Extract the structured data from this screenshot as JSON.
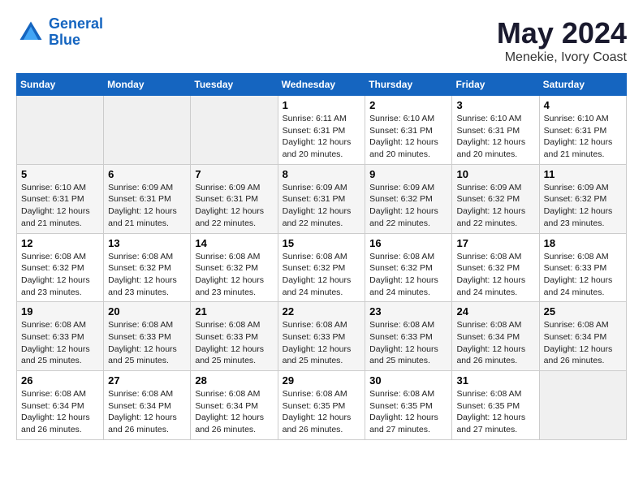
{
  "header": {
    "logo_line1": "General",
    "logo_line2": "Blue",
    "month_year": "May 2024",
    "location": "Menekie, Ivory Coast"
  },
  "weekdays": [
    "Sunday",
    "Monday",
    "Tuesday",
    "Wednesday",
    "Thursday",
    "Friday",
    "Saturday"
  ],
  "weeks": [
    [
      null,
      null,
      null,
      {
        "day": "1",
        "sunrise": "Sunrise: 6:11 AM",
        "sunset": "Sunset: 6:31 PM",
        "daylight": "Daylight: 12 hours and 20 minutes."
      },
      {
        "day": "2",
        "sunrise": "Sunrise: 6:10 AM",
        "sunset": "Sunset: 6:31 PM",
        "daylight": "Daylight: 12 hours and 20 minutes."
      },
      {
        "day": "3",
        "sunrise": "Sunrise: 6:10 AM",
        "sunset": "Sunset: 6:31 PM",
        "daylight": "Daylight: 12 hours and 20 minutes."
      },
      {
        "day": "4",
        "sunrise": "Sunrise: 6:10 AM",
        "sunset": "Sunset: 6:31 PM",
        "daylight": "Daylight: 12 hours and 21 minutes."
      }
    ],
    [
      {
        "day": "5",
        "sunrise": "Sunrise: 6:10 AM",
        "sunset": "Sunset: 6:31 PM",
        "daylight": "Daylight: 12 hours and 21 minutes."
      },
      {
        "day": "6",
        "sunrise": "Sunrise: 6:09 AM",
        "sunset": "Sunset: 6:31 PM",
        "daylight": "Daylight: 12 hours and 21 minutes."
      },
      {
        "day": "7",
        "sunrise": "Sunrise: 6:09 AM",
        "sunset": "Sunset: 6:31 PM",
        "daylight": "Daylight: 12 hours and 22 minutes."
      },
      {
        "day": "8",
        "sunrise": "Sunrise: 6:09 AM",
        "sunset": "Sunset: 6:31 PM",
        "daylight": "Daylight: 12 hours and 22 minutes."
      },
      {
        "day": "9",
        "sunrise": "Sunrise: 6:09 AM",
        "sunset": "Sunset: 6:32 PM",
        "daylight": "Daylight: 12 hours and 22 minutes."
      },
      {
        "day": "10",
        "sunrise": "Sunrise: 6:09 AM",
        "sunset": "Sunset: 6:32 PM",
        "daylight": "Daylight: 12 hours and 22 minutes."
      },
      {
        "day": "11",
        "sunrise": "Sunrise: 6:09 AM",
        "sunset": "Sunset: 6:32 PM",
        "daylight": "Daylight: 12 hours and 23 minutes."
      }
    ],
    [
      {
        "day": "12",
        "sunrise": "Sunrise: 6:08 AM",
        "sunset": "Sunset: 6:32 PM",
        "daylight": "Daylight: 12 hours and 23 minutes."
      },
      {
        "day": "13",
        "sunrise": "Sunrise: 6:08 AM",
        "sunset": "Sunset: 6:32 PM",
        "daylight": "Daylight: 12 hours and 23 minutes."
      },
      {
        "day": "14",
        "sunrise": "Sunrise: 6:08 AM",
        "sunset": "Sunset: 6:32 PM",
        "daylight": "Daylight: 12 hours and 23 minutes."
      },
      {
        "day": "15",
        "sunrise": "Sunrise: 6:08 AM",
        "sunset": "Sunset: 6:32 PM",
        "daylight": "Daylight: 12 hours and 24 minutes."
      },
      {
        "day": "16",
        "sunrise": "Sunrise: 6:08 AM",
        "sunset": "Sunset: 6:32 PM",
        "daylight": "Daylight: 12 hours and 24 minutes."
      },
      {
        "day": "17",
        "sunrise": "Sunrise: 6:08 AM",
        "sunset": "Sunset: 6:32 PM",
        "daylight": "Daylight: 12 hours and 24 minutes."
      },
      {
        "day": "18",
        "sunrise": "Sunrise: 6:08 AM",
        "sunset": "Sunset: 6:33 PM",
        "daylight": "Daylight: 12 hours and 24 minutes."
      }
    ],
    [
      {
        "day": "19",
        "sunrise": "Sunrise: 6:08 AM",
        "sunset": "Sunset: 6:33 PM",
        "daylight": "Daylight: 12 hours and 25 minutes."
      },
      {
        "day": "20",
        "sunrise": "Sunrise: 6:08 AM",
        "sunset": "Sunset: 6:33 PM",
        "daylight": "Daylight: 12 hours and 25 minutes."
      },
      {
        "day": "21",
        "sunrise": "Sunrise: 6:08 AM",
        "sunset": "Sunset: 6:33 PM",
        "daylight": "Daylight: 12 hours and 25 minutes."
      },
      {
        "day": "22",
        "sunrise": "Sunrise: 6:08 AM",
        "sunset": "Sunset: 6:33 PM",
        "daylight": "Daylight: 12 hours and 25 minutes."
      },
      {
        "day": "23",
        "sunrise": "Sunrise: 6:08 AM",
        "sunset": "Sunset: 6:33 PM",
        "daylight": "Daylight: 12 hours and 25 minutes."
      },
      {
        "day": "24",
        "sunrise": "Sunrise: 6:08 AM",
        "sunset": "Sunset: 6:34 PM",
        "daylight": "Daylight: 12 hours and 26 minutes."
      },
      {
        "day": "25",
        "sunrise": "Sunrise: 6:08 AM",
        "sunset": "Sunset: 6:34 PM",
        "daylight": "Daylight: 12 hours and 26 minutes."
      }
    ],
    [
      {
        "day": "26",
        "sunrise": "Sunrise: 6:08 AM",
        "sunset": "Sunset: 6:34 PM",
        "daylight": "Daylight: 12 hours and 26 minutes."
      },
      {
        "day": "27",
        "sunrise": "Sunrise: 6:08 AM",
        "sunset": "Sunset: 6:34 PM",
        "daylight": "Daylight: 12 hours and 26 minutes."
      },
      {
        "day": "28",
        "sunrise": "Sunrise: 6:08 AM",
        "sunset": "Sunset: 6:34 PM",
        "daylight": "Daylight: 12 hours and 26 minutes."
      },
      {
        "day": "29",
        "sunrise": "Sunrise: 6:08 AM",
        "sunset": "Sunset: 6:35 PM",
        "daylight": "Daylight: 12 hours and 26 minutes."
      },
      {
        "day": "30",
        "sunrise": "Sunrise: 6:08 AM",
        "sunset": "Sunset: 6:35 PM",
        "daylight": "Daylight: 12 hours and 27 minutes."
      },
      {
        "day": "31",
        "sunrise": "Sunrise: 6:08 AM",
        "sunset": "Sunset: 6:35 PM",
        "daylight": "Daylight: 12 hours and 27 minutes."
      },
      null
    ]
  ]
}
